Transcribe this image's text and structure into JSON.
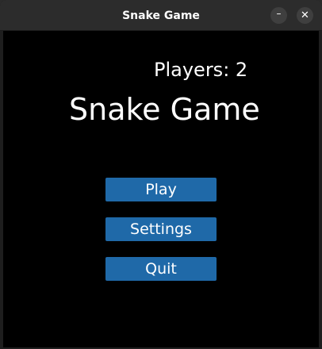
{
  "window": {
    "title": "Snake Game",
    "minimize_icon": "–",
    "close_icon": "✕"
  },
  "game": {
    "players_label": "Players: 2",
    "title": "Snake Game",
    "menu": {
      "play": "Play",
      "settings": "Settings",
      "quit": "Quit"
    }
  },
  "colors": {
    "background": "#000000",
    "button": "#1f69a8",
    "text": "#ffffff",
    "titlebar": "#2c2c2c"
  }
}
